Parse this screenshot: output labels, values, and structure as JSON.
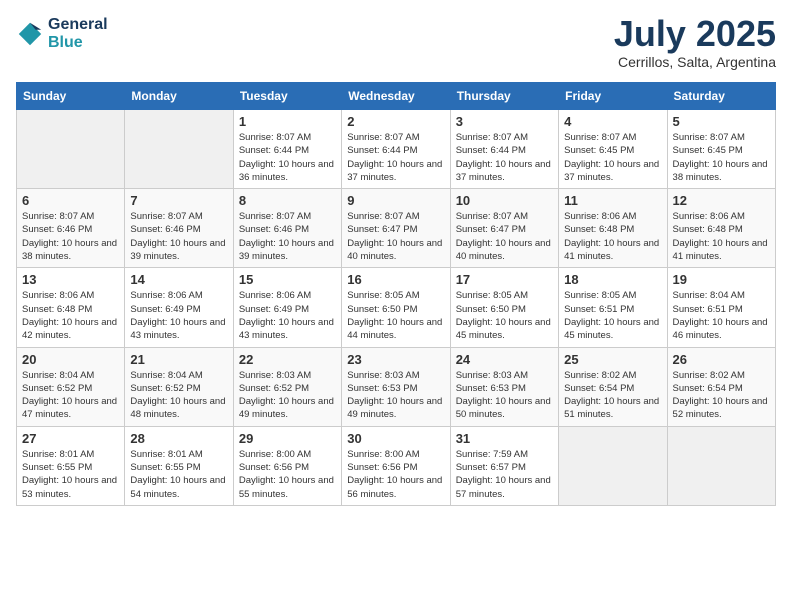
{
  "header": {
    "logo_line1": "General",
    "logo_line2": "Blue",
    "month": "July 2025",
    "location": "Cerrillos, Salta, Argentina"
  },
  "weekdays": [
    "Sunday",
    "Monday",
    "Tuesday",
    "Wednesday",
    "Thursday",
    "Friday",
    "Saturday"
  ],
  "weeks": [
    [
      {
        "day": "",
        "info": ""
      },
      {
        "day": "",
        "info": ""
      },
      {
        "day": "1",
        "info": "Sunrise: 8:07 AM\nSunset: 6:44 PM\nDaylight: 10 hours and 36 minutes."
      },
      {
        "day": "2",
        "info": "Sunrise: 8:07 AM\nSunset: 6:44 PM\nDaylight: 10 hours and 37 minutes."
      },
      {
        "day": "3",
        "info": "Sunrise: 8:07 AM\nSunset: 6:44 PM\nDaylight: 10 hours and 37 minutes."
      },
      {
        "day": "4",
        "info": "Sunrise: 8:07 AM\nSunset: 6:45 PM\nDaylight: 10 hours and 37 minutes."
      },
      {
        "day": "5",
        "info": "Sunrise: 8:07 AM\nSunset: 6:45 PM\nDaylight: 10 hours and 38 minutes."
      }
    ],
    [
      {
        "day": "6",
        "info": "Sunrise: 8:07 AM\nSunset: 6:46 PM\nDaylight: 10 hours and 38 minutes."
      },
      {
        "day": "7",
        "info": "Sunrise: 8:07 AM\nSunset: 6:46 PM\nDaylight: 10 hours and 39 minutes."
      },
      {
        "day": "8",
        "info": "Sunrise: 8:07 AM\nSunset: 6:46 PM\nDaylight: 10 hours and 39 minutes."
      },
      {
        "day": "9",
        "info": "Sunrise: 8:07 AM\nSunset: 6:47 PM\nDaylight: 10 hours and 40 minutes."
      },
      {
        "day": "10",
        "info": "Sunrise: 8:07 AM\nSunset: 6:47 PM\nDaylight: 10 hours and 40 minutes."
      },
      {
        "day": "11",
        "info": "Sunrise: 8:06 AM\nSunset: 6:48 PM\nDaylight: 10 hours and 41 minutes."
      },
      {
        "day": "12",
        "info": "Sunrise: 8:06 AM\nSunset: 6:48 PM\nDaylight: 10 hours and 41 minutes."
      }
    ],
    [
      {
        "day": "13",
        "info": "Sunrise: 8:06 AM\nSunset: 6:48 PM\nDaylight: 10 hours and 42 minutes."
      },
      {
        "day": "14",
        "info": "Sunrise: 8:06 AM\nSunset: 6:49 PM\nDaylight: 10 hours and 43 minutes."
      },
      {
        "day": "15",
        "info": "Sunrise: 8:06 AM\nSunset: 6:49 PM\nDaylight: 10 hours and 43 minutes."
      },
      {
        "day": "16",
        "info": "Sunrise: 8:05 AM\nSunset: 6:50 PM\nDaylight: 10 hours and 44 minutes."
      },
      {
        "day": "17",
        "info": "Sunrise: 8:05 AM\nSunset: 6:50 PM\nDaylight: 10 hours and 45 minutes."
      },
      {
        "day": "18",
        "info": "Sunrise: 8:05 AM\nSunset: 6:51 PM\nDaylight: 10 hours and 45 minutes."
      },
      {
        "day": "19",
        "info": "Sunrise: 8:04 AM\nSunset: 6:51 PM\nDaylight: 10 hours and 46 minutes."
      }
    ],
    [
      {
        "day": "20",
        "info": "Sunrise: 8:04 AM\nSunset: 6:52 PM\nDaylight: 10 hours and 47 minutes."
      },
      {
        "day": "21",
        "info": "Sunrise: 8:04 AM\nSunset: 6:52 PM\nDaylight: 10 hours and 48 minutes."
      },
      {
        "day": "22",
        "info": "Sunrise: 8:03 AM\nSunset: 6:52 PM\nDaylight: 10 hours and 49 minutes."
      },
      {
        "day": "23",
        "info": "Sunrise: 8:03 AM\nSunset: 6:53 PM\nDaylight: 10 hours and 49 minutes."
      },
      {
        "day": "24",
        "info": "Sunrise: 8:03 AM\nSunset: 6:53 PM\nDaylight: 10 hours and 50 minutes."
      },
      {
        "day": "25",
        "info": "Sunrise: 8:02 AM\nSunset: 6:54 PM\nDaylight: 10 hours and 51 minutes."
      },
      {
        "day": "26",
        "info": "Sunrise: 8:02 AM\nSunset: 6:54 PM\nDaylight: 10 hours and 52 minutes."
      }
    ],
    [
      {
        "day": "27",
        "info": "Sunrise: 8:01 AM\nSunset: 6:55 PM\nDaylight: 10 hours and 53 minutes."
      },
      {
        "day": "28",
        "info": "Sunrise: 8:01 AM\nSunset: 6:55 PM\nDaylight: 10 hours and 54 minutes."
      },
      {
        "day": "29",
        "info": "Sunrise: 8:00 AM\nSunset: 6:56 PM\nDaylight: 10 hours and 55 minutes."
      },
      {
        "day": "30",
        "info": "Sunrise: 8:00 AM\nSunset: 6:56 PM\nDaylight: 10 hours and 56 minutes."
      },
      {
        "day": "31",
        "info": "Sunrise: 7:59 AM\nSunset: 6:57 PM\nDaylight: 10 hours and 57 minutes."
      },
      {
        "day": "",
        "info": ""
      },
      {
        "day": "",
        "info": ""
      }
    ]
  ]
}
